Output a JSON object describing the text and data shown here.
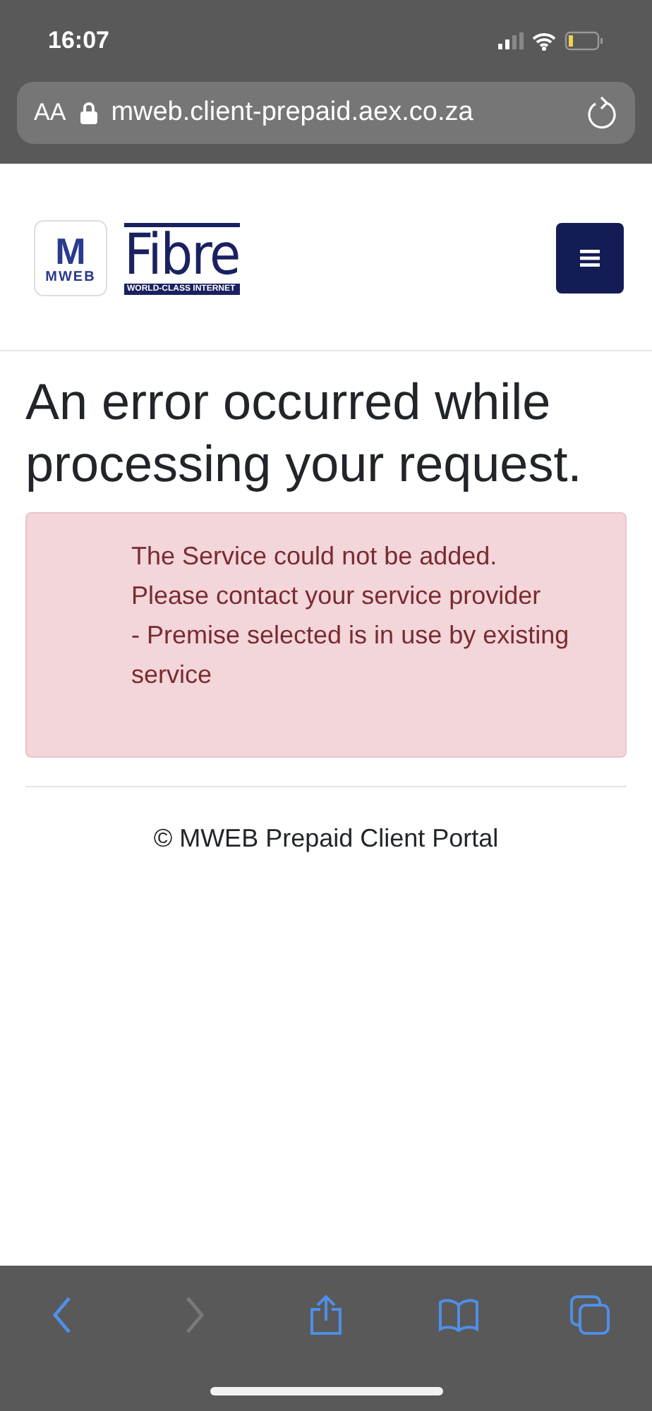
{
  "status_bar": {
    "time": "16:07"
  },
  "address_bar": {
    "text_size": "AA",
    "url": "mweb.client-prepaid.aex.co.za"
  },
  "logo": {
    "badge_letter": "M",
    "badge_text": "MWEB",
    "word": "Fibre",
    "tagline": "WORLD-CLASS INTERNET"
  },
  "heading": "An error occurred while processing your request.",
  "alert": {
    "lines": [
      "The Service could not be added.",
      "Please contact your service provider",
      "- Premise selected is in use by existing service"
    ]
  },
  "footer": "© MWEB Prepaid Client Portal",
  "toolbar": [
    {
      "kind": "back",
      "disabled": false
    },
    {
      "kind": "forward",
      "disabled": true
    },
    {
      "kind": "share",
      "disabled": false
    },
    {
      "kind": "bookmarks",
      "disabled": false
    },
    {
      "kind": "tabs",
      "disabled": false
    }
  ]
}
